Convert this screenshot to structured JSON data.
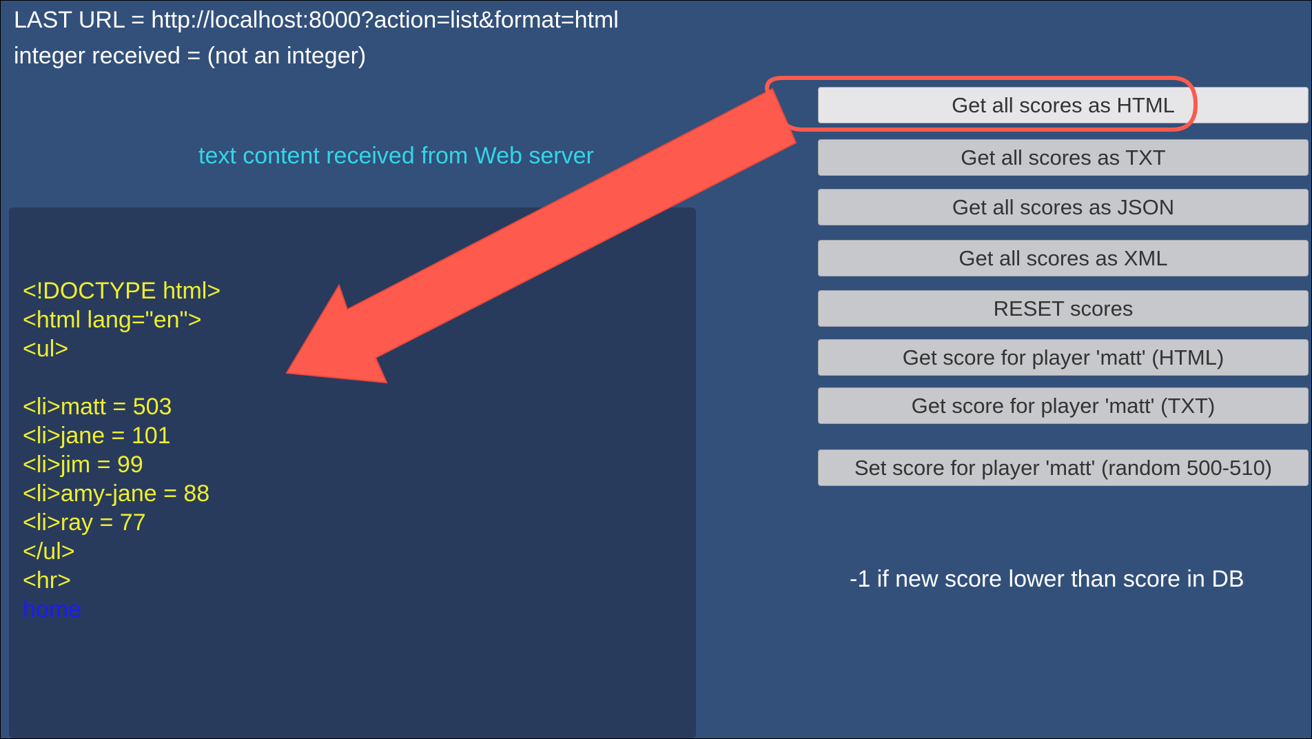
{
  "status": {
    "last_url": "LAST URL = http://localhost:8000?action=list&format=html",
    "integer_received": "integer received = (not an integer)"
  },
  "caption": "text content received from Web server",
  "response_lines": [
    "<!DOCTYPE html>",
    "<html lang=\"en\">",
    "<ul>",
    "",
    "<li>matt = 503",
    "<li>jane = 101",
    "<li>jim = 99",
    "<li>amy-jane = 88",
    "<li>ray = 77",
    "</ul>",
    "<hr>"
  ],
  "home_link": "home",
  "buttons": [
    "Get all scores as HTML",
    "Get all scores as TXT",
    "Get all scores as JSON",
    "Get all scores as XML",
    "RESET scores",
    "Get score for player 'matt' (HTML)",
    "Get score for player 'matt' (TXT)",
    "Set score for player 'matt' (random 500-510)"
  ],
  "note": "-1 if new score lower than score in DB",
  "colors": {
    "background": "#32507a",
    "panel": "#283b5d",
    "code_text": "#f0ef2c",
    "caption_text": "#34d6e6",
    "link": "#1a1aff",
    "annotation": "#ff5a4e"
  }
}
